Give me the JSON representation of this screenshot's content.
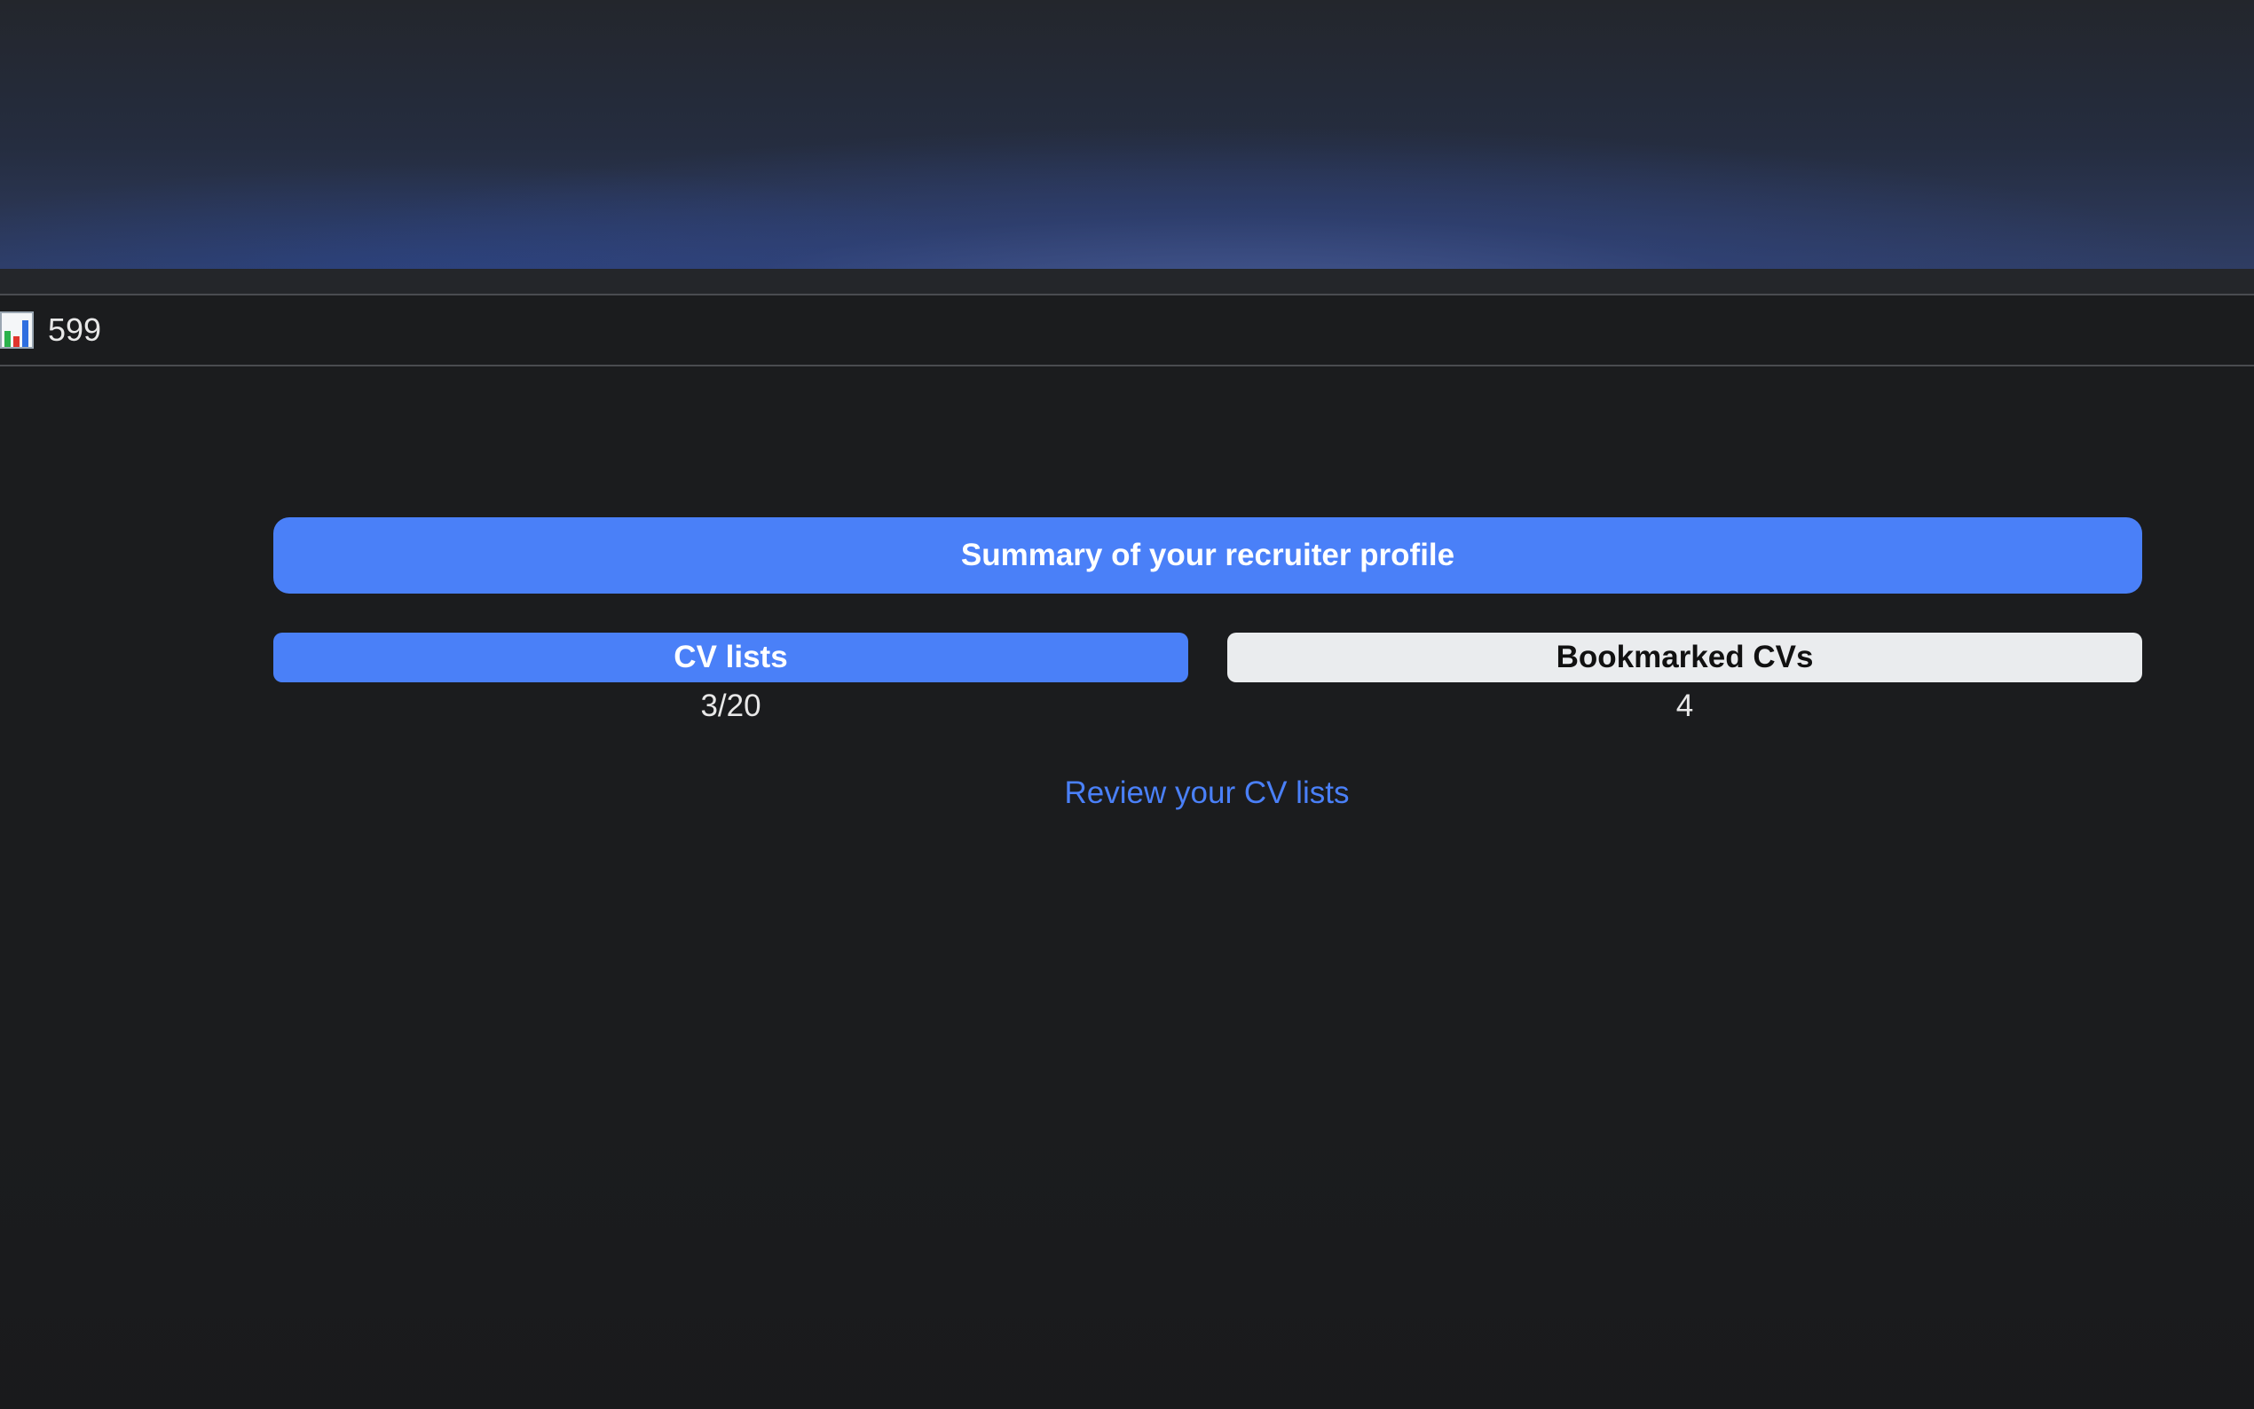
{
  "header": {
    "stats": {
      "icon": "bar-chart-icon",
      "value": "599"
    }
  },
  "summary": {
    "title": "Summary of your recruiter profile"
  },
  "tabs": [
    {
      "label": "CV lists",
      "count": "3/20",
      "active": true
    },
    {
      "label": "Bookmarked CVs",
      "count": "4",
      "active": false
    }
  ],
  "review_link": {
    "label": "Review your CV lists"
  },
  "colors": {
    "accent": "#4a80f8",
    "background": "#1b1c1e",
    "inactive_tab": "#eaecee"
  }
}
